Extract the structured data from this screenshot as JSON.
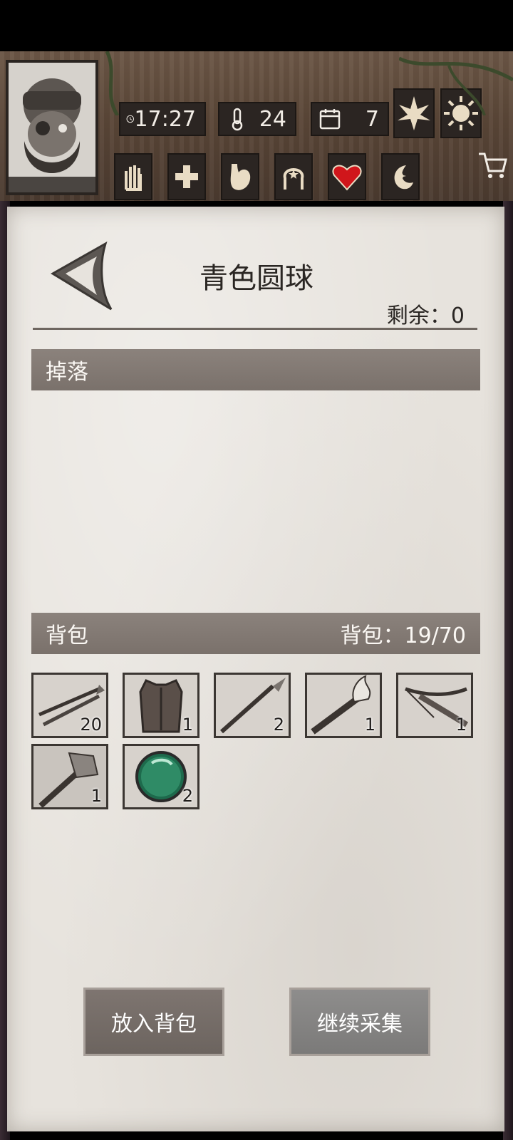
{
  "hud": {
    "time": "17:27",
    "temperature": "24",
    "day": "7",
    "season_icon": "leaf-icon",
    "weather_icon": "sun-icon",
    "status_icons": [
      "hand-bandage-icon",
      "plus-icon",
      "stomach-icon",
      "head-icon",
      "heart-icon",
      "moon-icon"
    ]
  },
  "item": {
    "title": "青色圆球",
    "remaining": "剩余：0"
  },
  "sections": {
    "drop_label": "掉落",
    "bag_label": "背包",
    "bag_capacity": "背包：19/70"
  },
  "inventory": [
    {
      "name": "arrows",
      "count": "20"
    },
    {
      "name": "leather-vest",
      "count": "1"
    },
    {
      "name": "spear",
      "count": "2"
    },
    {
      "name": "torch",
      "count": "1"
    },
    {
      "name": "crossbow",
      "count": "1"
    },
    {
      "name": "hammer",
      "count": "1"
    },
    {
      "name": "green-orb",
      "count": "2"
    }
  ],
  "buttons": {
    "put_in_bag": "放入背包",
    "continue_gather": "继续采集"
  },
  "colors": {
    "paper": "#e7e3dd",
    "section_bar": "#817873",
    "wood": "#5a4637",
    "heart": "#d0161b"
  }
}
